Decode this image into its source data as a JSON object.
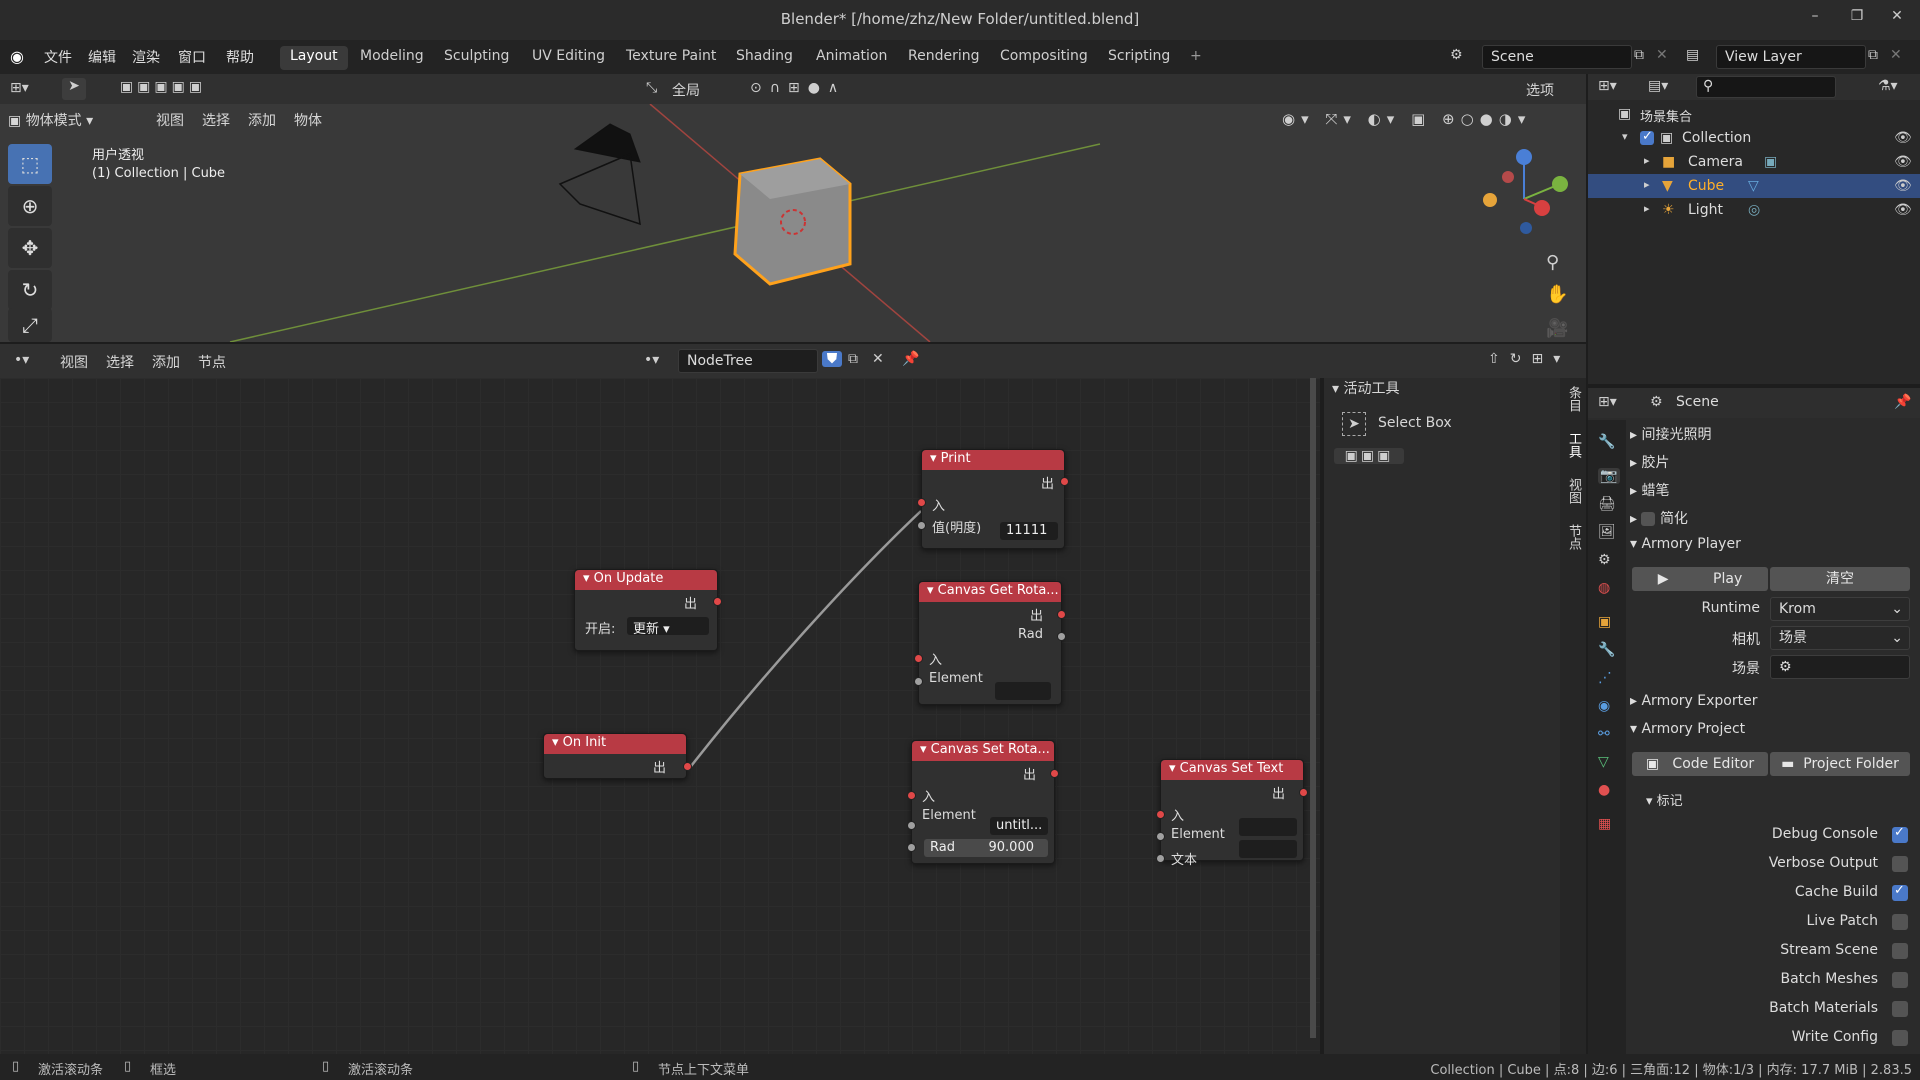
{
  "window": {
    "title": "Blender* [/home/zhz/New Folder/untitled.blend]"
  },
  "menu": [
    "文件",
    "编辑",
    "渲染",
    "窗口",
    "帮助"
  ],
  "workspaces": [
    "Layout",
    "Modeling",
    "Sculpting",
    "UV Editing",
    "Texture Paint",
    "Shading",
    "Animation",
    "Rendering",
    "Compositing",
    "Scripting",
    "+"
  ],
  "scene": {
    "name": "Scene",
    "view_layer": "View Layer"
  },
  "viewport": {
    "mode": "物体模式",
    "menus": [
      "视图",
      "选择",
      "添加",
      "物体"
    ],
    "transform": "全局",
    "options": "选项",
    "overlay_title": "用户透视",
    "overlay_sub": "(1) Collection | Cube"
  },
  "outliner": {
    "root": "场景集合",
    "collection": "Collection",
    "items": [
      "Camera",
      "Cube",
      "Light"
    ],
    "selected": "Cube"
  },
  "node_editor": {
    "menus": [
      "视图",
      "选择",
      "添加",
      "节点"
    ],
    "tree": "NodeTree"
  },
  "nodes": {
    "print": {
      "title": "Print",
      "out": "出",
      "in": "入",
      "field": "值(明度)",
      "value": "11111"
    },
    "on_update": {
      "title": "On Update",
      "out": "出",
      "label": "开启:",
      "value": "更新"
    },
    "on_init": {
      "title": "On Init",
      "out": "出"
    },
    "get_rot": {
      "title": "Canvas Get Rota...",
      "out": "出",
      "rad": "Rad",
      "in": "入",
      "element": "Element"
    },
    "set_rot": {
      "title": "Canvas Set Rota...",
      "out": "出",
      "in": "入",
      "element": "Element",
      "element_val": "untitl...",
      "rad": "Rad",
      "rad_val": "90.000"
    },
    "set_text": {
      "title": "Canvas Set Text",
      "out": "出",
      "in": "入",
      "element": "Element",
      "text": "文本"
    }
  },
  "side_panel": {
    "header": "活动工具",
    "tool": "Select Box",
    "tabs": [
      "条目",
      "工具",
      "视图",
      "节点"
    ]
  },
  "properties": {
    "scene": "Scene",
    "sections": [
      "间接光照明",
      "胶片",
      "蜡笔",
      "简化"
    ],
    "armory_player": "Armory Player",
    "play": "Play",
    "clear": "清空",
    "runtime_label": "Runtime",
    "runtime": "Krom",
    "camera_label": "相机",
    "camera": "场景",
    "scene_label": "场景",
    "armory_exporter": "Armory Exporter",
    "armory_project": "Armory Project",
    "code_editor": "Code Editor",
    "project_folder": "Project Folder",
    "flags": "标记",
    "checks": [
      {
        "label": "Debug Console",
        "on": true
      },
      {
        "label": "Verbose Output",
        "on": false
      },
      {
        "label": "Cache Build",
        "on": true
      },
      {
        "label": "Live Patch",
        "on": false
      },
      {
        "label": "Stream Scene",
        "on": false
      },
      {
        "label": "Batch Meshes",
        "on": false
      },
      {
        "label": "Batch Materials",
        "on": false
      },
      {
        "label": "Write Config",
        "on": false
      }
    ]
  },
  "status": {
    "left1": "激活滚动条",
    "left2": "框选",
    "mid": "激活滚动条",
    "ctx": "节点上下文菜单",
    "right": "Collection | Cube | 点:8 | 边:6 | 三角面:12 | 物体:1/3 | 内存: 17.7 MiB | 2.83.5"
  },
  "colors": {
    "node_header": "#b83a44",
    "selected": "#334d80",
    "accent": "#4a79c9"
  }
}
